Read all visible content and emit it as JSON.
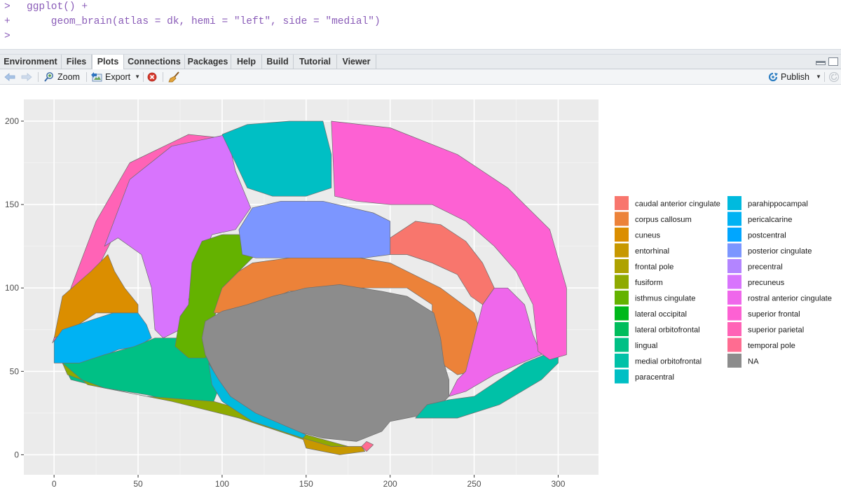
{
  "console": {
    "lines": [
      {
        "prompt": ">",
        "code": "ggplot() +"
      },
      {
        "prompt": "+",
        "code": "    geom_brain(atlas = dk, hemi = \"left\", side = \"medial\")"
      },
      {
        "prompt": ">",
        "code": ""
      }
    ]
  },
  "tabs": [
    {
      "label": "Environment",
      "active": false
    },
    {
      "label": "Files",
      "active": false
    },
    {
      "label": "Plots",
      "active": true
    },
    {
      "label": "Connections",
      "active": false
    },
    {
      "label": "Packages",
      "active": false
    },
    {
      "label": "Help",
      "active": false
    },
    {
      "label": "Build",
      "active": false
    },
    {
      "label": "Tutorial",
      "active": false
    },
    {
      "label": "Viewer",
      "active": false
    }
  ],
  "toolbar": {
    "zoom_label": "Zoom",
    "export_label": "Export",
    "publish_label": "Publish"
  },
  "chart_data": {
    "type": "polygon",
    "x_ticks": [
      0,
      50,
      100,
      150,
      200,
      250,
      300
    ],
    "y_ticks": [
      0,
      50,
      100,
      150,
      200
    ],
    "xlim": [
      -18,
      324
    ],
    "ylim": [
      -12,
      213
    ],
    "grid": true,
    "legend_position": "right",
    "legend": [
      {
        "label": "caudal anterior cingulate",
        "color": "#F8766D"
      },
      {
        "label": "corpus callosum",
        "color": "#EC8239"
      },
      {
        "label": "cuneus",
        "color": "#DB8E00"
      },
      {
        "label": "entorhinal",
        "color": "#C79800"
      },
      {
        "label": "frontal pole",
        "color": "#AEA200"
      },
      {
        "label": "fusiform",
        "color": "#8FAA00"
      },
      {
        "label": "isthmus cingulate",
        "color": "#64B200"
      },
      {
        "label": "lateral occipital",
        "color": "#00B81B"
      },
      {
        "label": "lateral orbitofrontal",
        "color": "#00BD5C"
      },
      {
        "label": "lingual",
        "color": "#00C085"
      },
      {
        "label": "medial orbitofrontal",
        "color": "#00C1A7"
      },
      {
        "label": "paracentral",
        "color": "#00BFC4"
      },
      {
        "label": "parahippocampal",
        "color": "#00BADE"
      },
      {
        "label": "pericalcarine",
        "color": "#00B2F3"
      },
      {
        "label": "postcentral",
        "color": "#00A6FF"
      },
      {
        "label": "posterior cingulate",
        "color": "#7C96FF"
      },
      {
        "label": "precentral",
        "color": "#B385FF"
      },
      {
        "label": "precuneus",
        "color": "#D874FD"
      },
      {
        "label": "rostral anterior cingulate",
        "color": "#EF67EB"
      },
      {
        "label": "superior frontal",
        "color": "#FD61D3"
      },
      {
        "label": "superior parietal",
        "color": "#FF63B6"
      },
      {
        "label": "temporal pole",
        "color": "#FF6C91"
      },
      {
        "label": "NA",
        "color": "#8C8C8C"
      }
    ],
    "regions": [
      {
        "region": "superior parietal",
        "color": "#FF63B6",
        "points": [
          [
            -1,
            67
          ],
          [
            10,
            100
          ],
          [
            25,
            140
          ],
          [
            45,
            175
          ],
          [
            80,
            192
          ],
          [
            100,
            190
          ],
          [
            100,
            180
          ],
          [
            60,
            165
          ],
          [
            35,
            130
          ],
          [
            20,
            100
          ],
          [
            5,
            75
          ]
        ]
      },
      {
        "region": "precuneus",
        "color": "#D874FD",
        "points": [
          [
            30,
            125
          ],
          [
            45,
            165
          ],
          [
            70,
            185
          ],
          [
            103,
            192
          ],
          [
            108,
            170
          ],
          [
            117,
            148
          ],
          [
            108,
            135
          ],
          [
            94,
            132
          ],
          [
            88,
            118
          ],
          [
            80,
            93
          ],
          [
            85,
            80
          ],
          [
            75,
            75
          ],
          [
            65,
            70
          ],
          [
            60,
            75
          ],
          [
            58,
            100
          ],
          [
            52,
            120
          ],
          [
            38,
            130
          ]
        ]
      },
      {
        "region": "cuneus",
        "color": "#DB8E00",
        "points": [
          [
            0,
            70
          ],
          [
            5,
            95
          ],
          [
            22,
            110
          ],
          [
            32,
            120
          ],
          [
            36,
            110
          ],
          [
            42,
            100
          ],
          [
            50,
            90
          ],
          [
            50,
            85
          ],
          [
            40,
            85
          ],
          [
            25,
            85
          ],
          [
            10,
            75
          ]
        ]
      },
      {
        "region": "pericalcarine",
        "color": "#00B2F3",
        "points": [
          [
            0,
            68
          ],
          [
            0,
            55
          ],
          [
            5,
            55
          ],
          [
            20,
            55
          ],
          [
            38,
            63
          ],
          [
            50,
            65
          ],
          [
            58,
            70
          ],
          [
            55,
            78
          ],
          [
            50,
            85
          ],
          [
            35,
            85
          ],
          [
            20,
            80
          ],
          [
            5,
            75
          ]
        ]
      },
      {
        "region": "lingual",
        "color": "#00C085",
        "points": [
          [
            5,
            55
          ],
          [
            10,
            45
          ],
          [
            30,
            40
          ],
          [
            55,
            36
          ],
          [
            80,
            30
          ],
          [
            95,
            32
          ],
          [
            100,
            45
          ],
          [
            95,
            62
          ],
          [
            80,
            70
          ],
          [
            70,
            70
          ],
          [
            60,
            70
          ],
          [
            48,
            65
          ],
          [
            30,
            60
          ],
          [
            15,
            55
          ]
        ]
      },
      {
        "region": "fusiform",
        "color": "#8FAA00",
        "points": [
          [
            5,
            55
          ],
          [
            20,
            42
          ],
          [
            55,
            35
          ],
          [
            95,
            32
          ],
          [
            120,
            25
          ],
          [
            150,
            12
          ],
          [
            175,
            5
          ],
          [
            180,
            3
          ],
          [
            160,
            5
          ],
          [
            140,
            12
          ],
          [
            110,
            22
          ],
          [
            70,
            32
          ],
          [
            30,
            40
          ],
          [
            8,
            48
          ]
        ]
      },
      {
        "region": "isthmus cingulate",
        "color": "#64B200",
        "points": [
          [
            72,
            65
          ],
          [
            75,
            83
          ],
          [
            80,
            90
          ],
          [
            82,
            115
          ],
          [
            88,
            128
          ],
          [
            100,
            132
          ],
          [
            110,
            132
          ],
          [
            115,
            128
          ],
          [
            120,
            120
          ],
          [
            110,
            110
          ],
          [
            100,
            100
          ],
          [
            95,
            80
          ],
          [
            95,
            65
          ],
          [
            90,
            58
          ],
          [
            80,
            58
          ]
        ]
      },
      {
        "region": "corpus callosum",
        "color": "#EC8239",
        "points": [
          [
            95,
            85
          ],
          [
            100,
            100
          ],
          [
            110,
            110
          ],
          [
            118,
            115
          ],
          [
            140,
            118
          ],
          [
            170,
            120
          ],
          [
            200,
            115
          ],
          [
            230,
            100
          ],
          [
            250,
            85
          ],
          [
            255,
            70
          ],
          [
            250,
            50
          ],
          [
            240,
            48
          ],
          [
            230,
            55
          ],
          [
            225,
            70
          ],
          [
            225,
            90
          ],
          [
            210,
            100
          ],
          [
            170,
            100
          ],
          [
            140,
            98
          ],
          [
            120,
            90
          ],
          [
            105,
            85
          ]
        ]
      },
      {
        "region": "NA",
        "color": "#8C8C8C",
        "points": [
          [
            90,
            80
          ],
          [
            88,
            70
          ],
          [
            90,
            60
          ],
          [
            95,
            50
          ],
          [
            100,
            40
          ],
          [
            108,
            30
          ],
          [
            120,
            22
          ],
          [
            140,
            15
          ],
          [
            160,
            10
          ],
          [
            180,
            8
          ],
          [
            195,
            14
          ],
          [
            200,
            20
          ],
          [
            210,
            22
          ],
          [
            225,
            25
          ],
          [
            235,
            35
          ],
          [
            235,
            45
          ],
          [
            232,
            55
          ],
          [
            230,
            70
          ],
          [
            226,
            85
          ],
          [
            210,
            95
          ],
          [
            195,
            98
          ],
          [
            170,
            102
          ],
          [
            150,
            100
          ],
          [
            130,
            95
          ],
          [
            115,
            90
          ],
          [
            100,
            86
          ]
        ]
      },
      {
        "region": "parahippocampal",
        "color": "#00BADE",
        "points": [
          [
            92,
            55
          ],
          [
            98,
            45
          ],
          [
            105,
            35
          ],
          [
            120,
            25
          ],
          [
            150,
            12
          ],
          [
            148,
            10
          ],
          [
            118,
            20
          ],
          [
            100,
            32
          ],
          [
            94,
            42
          ]
        ]
      },
      {
        "region": "entorhinal",
        "color": "#C79800",
        "points": [
          [
            148,
            10
          ],
          [
            165,
            5
          ],
          [
            183,
            5
          ],
          [
            185,
            2
          ],
          [
            170,
            0
          ],
          [
            150,
            4
          ]
        ]
      },
      {
        "region": "temporal pole",
        "color": "#FF6C91",
        "points": [
          [
            183,
            5
          ],
          [
            186,
            2
          ],
          [
            190,
            6
          ],
          [
            186,
            8
          ]
        ]
      },
      {
        "region": "medial orbitofrontal",
        "color": "#00C1A7",
        "points": [
          [
            215,
            22
          ],
          [
            240,
            22
          ],
          [
            265,
            30
          ],
          [
            290,
            45
          ],
          [
            300,
            55
          ],
          [
            300,
            62
          ],
          [
            292,
            60
          ],
          [
            280,
            55
          ],
          [
            265,
            45
          ],
          [
            250,
            35
          ],
          [
            235,
            33
          ],
          [
            222,
            30
          ]
        ]
      },
      {
        "region": "rostral anterior cingulate",
        "color": "#EF67EB",
        "points": [
          [
            235,
            35
          ],
          [
            245,
            38
          ],
          [
            262,
            48
          ],
          [
            278,
            55
          ],
          [
            290,
            60
          ],
          [
            285,
            72
          ],
          [
            280,
            90
          ],
          [
            270,
            100
          ],
          [
            262,
            100
          ],
          [
            255,
            90
          ],
          [
            250,
            70
          ],
          [
            245,
            50
          ],
          [
            240,
            45
          ]
        ]
      },
      {
        "region": "caudal anterior cingulate",
        "color": "#F8766D",
        "points": [
          [
            200,
            130
          ],
          [
            215,
            140
          ],
          [
            230,
            138
          ],
          [
            245,
            128
          ],
          [
            255,
            115
          ],
          [
            262,
            100
          ],
          [
            255,
            90
          ],
          [
            248,
            95
          ],
          [
            240,
            108
          ],
          [
            225,
            115
          ],
          [
            210,
            120
          ],
          [
            200,
            120
          ]
        ]
      },
      {
        "region": "posterior cingulate",
        "color": "#7C96FF",
        "points": [
          [
            110,
            135
          ],
          [
            118,
            148
          ],
          [
            135,
            152
          ],
          [
            160,
            152
          ],
          [
            190,
            145
          ],
          [
            200,
            140
          ],
          [
            200,
            120
          ],
          [
            185,
            118
          ],
          [
            160,
            118
          ],
          [
            140,
            118
          ],
          [
            120,
            118
          ],
          [
            112,
            120
          ]
        ]
      },
      {
        "region": "paracentral",
        "color": "#00BFC4",
        "points": [
          [
            100,
            192
          ],
          [
            115,
            198
          ],
          [
            140,
            200
          ],
          [
            160,
            200
          ],
          [
            165,
            180
          ],
          [
            165,
            160
          ],
          [
            150,
            155
          ],
          [
            130,
            155
          ],
          [
            115,
            160
          ],
          [
            108,
            175
          ]
        ]
      },
      {
        "region": "superior frontal",
        "color": "#FD61D3",
        "points": [
          [
            165,
            200
          ],
          [
            200,
            196
          ],
          [
            240,
            180
          ],
          [
            270,
            160
          ],
          [
            295,
            135
          ],
          [
            305,
            100
          ],
          [
            305,
            60
          ],
          [
            295,
            57
          ],
          [
            288,
            62
          ],
          [
            285,
            90
          ],
          [
            275,
            110
          ],
          [
            262,
            125
          ],
          [
            245,
            140
          ],
          [
            225,
            150
          ],
          [
            200,
            150
          ],
          [
            180,
            152
          ],
          [
            167,
            155
          ]
        ]
      }
    ]
  }
}
